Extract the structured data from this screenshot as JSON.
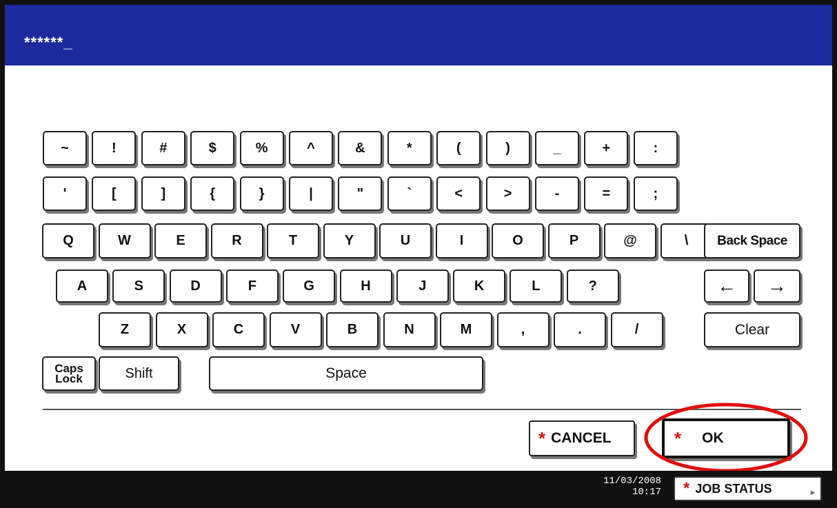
{
  "input": {
    "masked_value": "******_"
  },
  "keyboard": {
    "row1": [
      "~",
      "!",
      "#",
      "$",
      "%",
      "^",
      "&",
      "*",
      "(",
      ")",
      "_",
      "+",
      ":"
    ],
    "row2": [
      "'",
      "[",
      "]",
      "{",
      "}",
      "|",
      "\"",
      "`",
      "<",
      ">",
      "-",
      "=",
      ";"
    ],
    "row3": [
      "Q",
      "W",
      "E",
      "R",
      "T",
      "Y",
      "U",
      "I",
      "O",
      "P",
      "@",
      "\\"
    ],
    "row4": [
      "A",
      "S",
      "D",
      "F",
      "G",
      "H",
      "J",
      "K",
      "L",
      "?"
    ],
    "row5": [
      "Z",
      "X",
      "C",
      "V",
      "B",
      "N",
      "M",
      ",",
      ".",
      "/"
    ],
    "backspace": "Back Space",
    "arrow_left": "←",
    "arrow_right": "→",
    "clear": "Clear",
    "caps_lock": "Caps Lock",
    "shift": "Shift",
    "space": "Space"
  },
  "actions": {
    "cancel_label": "CANCEL",
    "ok_label": "OK",
    "star": "*",
    "highlight_color": "#e01010"
  },
  "footer": {
    "date": "11/03/2008",
    "time": "10:17",
    "job_status_label": "JOB STATUS",
    "job_status_arrow": "▸"
  },
  "colors": {
    "header": "#1c2a9e",
    "footer": "#111111",
    "star": "#e01010"
  }
}
